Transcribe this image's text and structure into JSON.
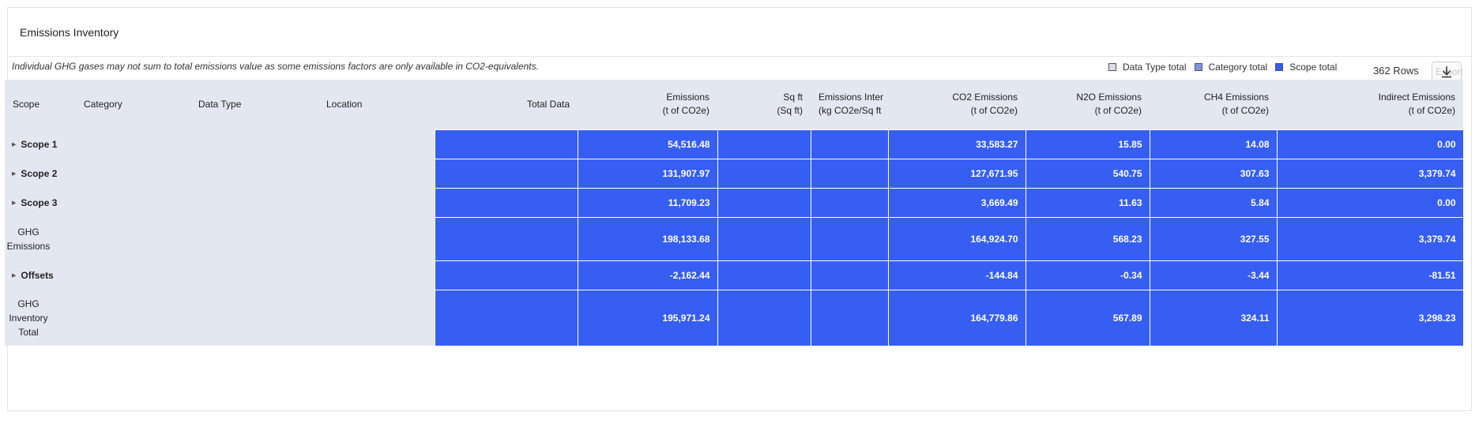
{
  "panel": {
    "title": "Emissions Inventory"
  },
  "info": {
    "disclaimer": "Individual GHG gases may not sum to total emissions value as some emissions factors are only available in CO2-equivalents.",
    "rows_count": "362 Rows",
    "export_label": "Export"
  },
  "legend": [
    {
      "label": "Data Type total",
      "color": "#d9dde9"
    },
    {
      "label": "Category total",
      "color": "#7d93e8"
    },
    {
      "label": "Scope total",
      "color": "#365ef3"
    }
  ],
  "columns": {
    "scope": "Scope",
    "category": "Category",
    "data_type": "Data Type",
    "location": "Location",
    "total_data": "Total Data",
    "emissions": {
      "title": "Emissions",
      "unit": "(t of CO2e)"
    },
    "sqft": {
      "title": "Sq ft",
      "unit": "(Sq ft)"
    },
    "intensity": {
      "title": "Emissions Inter",
      "unit": "(kg CO2e/Sq ft"
    },
    "co2": {
      "title": "CO2 Emissions",
      "unit": "(t of CO2e)"
    },
    "n2o": {
      "title": "N2O Emissions",
      "unit": "(t of CO2e)"
    },
    "ch4": {
      "title": "CH4 Emissions",
      "unit": "(t of CO2e)"
    },
    "indirect": {
      "title": "Indirect Emissions",
      "unit": "(t of CO2e)"
    }
  },
  "rows": [
    {
      "label": "Scope 1",
      "expandable": true,
      "emissions": "54,516.48",
      "co2": "33,583.27",
      "n2o": "15.85",
      "ch4": "14.08",
      "indirect": "0.00"
    },
    {
      "label": "Scope 2",
      "expandable": true,
      "emissions": "131,907.97",
      "co2": "127,671.95",
      "n2o": "540.75",
      "ch4": "307.63",
      "indirect": "3,379.74"
    },
    {
      "label": "Scope 3",
      "expandable": true,
      "emissions": "11,709.23",
      "co2": "3,669.49",
      "n2o": "11.63",
      "ch4": "5.84",
      "indirect": "0.00"
    },
    {
      "label": "GHG Emissions",
      "expandable": false,
      "emissions": "198,133.68",
      "co2": "164,924.70",
      "n2o": "568.23",
      "ch4": "327.55",
      "indirect": "3,379.74"
    },
    {
      "label": "Offsets",
      "expandable": true,
      "emissions": "-2,162.44",
      "co2": "-144.84",
      "n2o": "-0.34",
      "ch4": "-3.44",
      "indirect": "-81.51"
    },
    {
      "label": "GHG Inventory Total",
      "expandable": false,
      "emissions": "195,971.24",
      "co2": "164,779.86",
      "n2o": "567.89",
      "ch4": "324.11",
      "indirect": "3,298.23"
    }
  ]
}
